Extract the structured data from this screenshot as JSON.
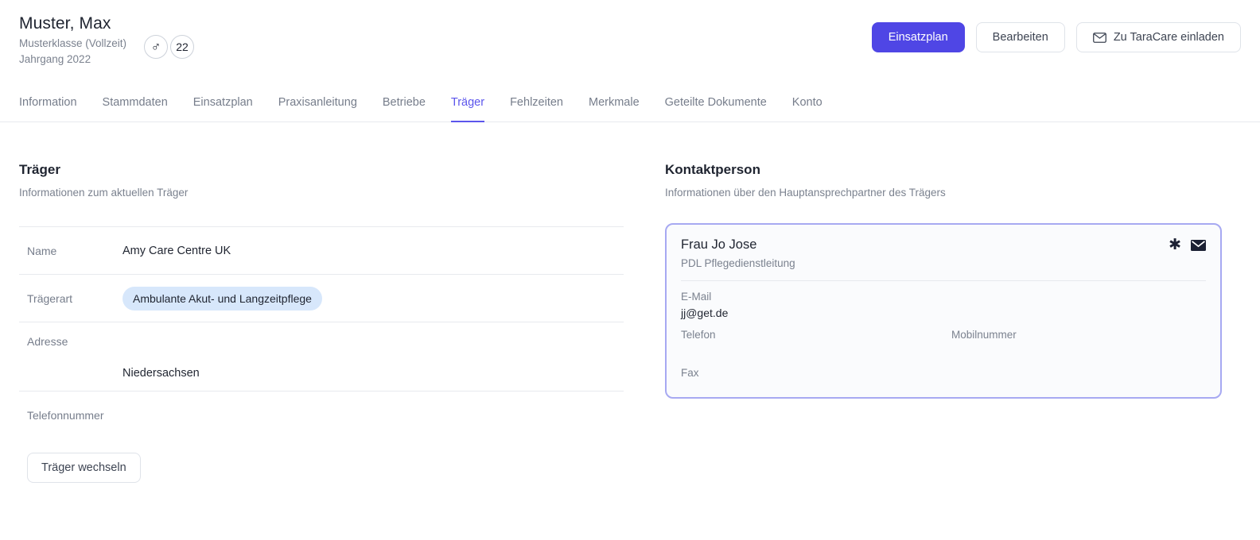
{
  "header": {
    "name": "Muster, Max",
    "class_line": "Musterklasse (Vollzeit)",
    "year_line": "Jahrgang 2022",
    "gender_symbol": "♂",
    "age": "22",
    "actions": {
      "primary_label": "Einsatzplan",
      "edit_label": "Bearbeiten",
      "invite_label": "Zu TaraCare einladen",
      "invite_icon": "mail-icon"
    }
  },
  "tabs": [
    {
      "label": "Information",
      "active": false
    },
    {
      "label": "Stammdaten",
      "active": false
    },
    {
      "label": "Einsatzplan",
      "active": false
    },
    {
      "label": "Praxisanleitung",
      "active": false
    },
    {
      "label": "Betriebe",
      "active": false
    },
    {
      "label": "Träger",
      "active": true
    },
    {
      "label": "Fehlzeiten",
      "active": false
    },
    {
      "label": "Merkmale",
      "active": false
    },
    {
      "label": "Geteilte Dokumente",
      "active": false
    },
    {
      "label": "Konto",
      "active": false
    }
  ],
  "traeger": {
    "title": "Träger",
    "subtitle": "Informationen zum aktuellen Träger",
    "rows": [
      {
        "label": "Name",
        "value": "Amy Care Centre UK",
        "style": "text"
      },
      {
        "label": "Trägerart",
        "value": "Ambulante Akut- und Langzeitpflege",
        "style": "pill"
      },
      {
        "label": "Adresse",
        "value": "Niedersachsen",
        "style": "stacked"
      },
      {
        "label": "Telefonnummer",
        "value": "",
        "style": "text"
      }
    ],
    "change_button_label": "Träger wechseln"
  },
  "kontaktperson": {
    "title": "Kontaktperson",
    "subtitle": "Informationen über den Hauptansprechpartner des Trägers",
    "card": {
      "name": "Frau Jo Jose",
      "role": "PDL Pflegedienstleitung",
      "star_icon": "asterisk-icon",
      "mail_icon": "envelope-icon",
      "fields": {
        "email_label": "E-Mail",
        "email_value": "jj@get.de",
        "phone_label": "Telefon",
        "phone_value": "",
        "mobile_label": "Mobilnummer",
        "mobile_value": "",
        "fax_label": "Fax",
        "fax_value": ""
      }
    }
  },
  "colors": {
    "primary": "#4f46e5",
    "tab_active": "#5b55ec",
    "card_border": "#a7a9f2",
    "pill_bg": "#d7e7fb",
    "muted_text": "#7b828f"
  }
}
